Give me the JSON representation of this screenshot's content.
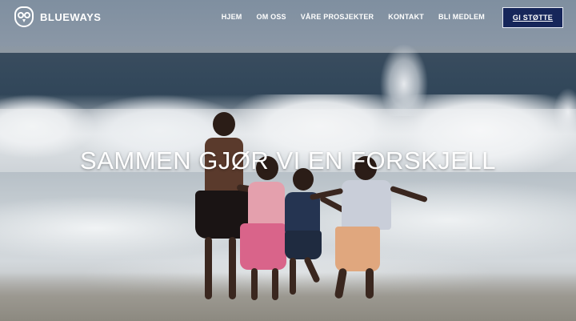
{
  "brand": {
    "name": "BLUEWAYS",
    "logo_icon": "owl-icon"
  },
  "nav": {
    "items": [
      "HJEM",
      "OM OSS",
      "VÅRE PROSJEKTER",
      "KONTAKT",
      "BLI MEDLEM"
    ]
  },
  "cta": {
    "label": "GI STØTTE",
    "color": "#16265a"
  },
  "hero": {
    "headline": "SAMMEN GJØR VI EN FORSKJELL"
  }
}
